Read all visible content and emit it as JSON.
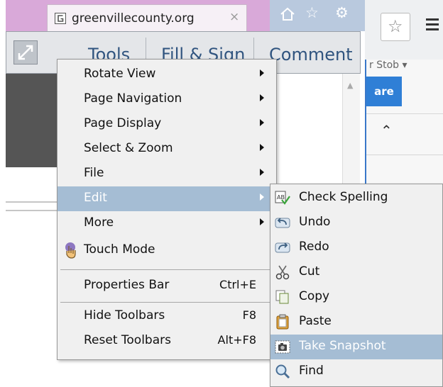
{
  "browser": {
    "tab_title": "greenvillecounty.org",
    "tab_close": "×",
    "nav_icons": [
      "home-icon",
      "star-icon",
      "gear-icon"
    ]
  },
  "toolbar": {
    "tools": "Tools",
    "fill_sign": "Fill & Sign",
    "comment": "Comment"
  },
  "right_panel": {
    "user": "r Stob ▾",
    "share": "are"
  },
  "menu": {
    "items": [
      {
        "label": "Rotate View",
        "submenu": true
      },
      {
        "label": "Page Navigation",
        "submenu": true
      },
      {
        "label": "Page Display",
        "submenu": true
      },
      {
        "label": "Select & Zoom",
        "submenu": true
      },
      {
        "label": "File",
        "submenu": true
      },
      {
        "label": "Edit",
        "submenu": true,
        "highlighted": true
      },
      {
        "label": "More",
        "submenu": true
      },
      {
        "label": "Touch Mode",
        "icon": "touch-hand-icon"
      },
      {
        "label": "Properties Bar",
        "shortcut": "Ctrl+E"
      },
      {
        "label": "Hide Toolbars",
        "shortcut": "F8"
      },
      {
        "label": "Reset Toolbars",
        "shortcut": "Alt+F8"
      }
    ]
  },
  "edit_submenu": {
    "items": [
      {
        "label": "Check Spelling",
        "icon": "spell-check-icon"
      },
      {
        "label": "Undo",
        "icon": "undo-icon"
      },
      {
        "label": "Redo",
        "icon": "redo-icon"
      },
      {
        "label": "Cut",
        "icon": "scissors-icon"
      },
      {
        "label": "Copy",
        "icon": "copy-icon"
      },
      {
        "label": "Paste",
        "icon": "paste-icon"
      },
      {
        "label": "Take Snapshot",
        "icon": "camera-icon",
        "highlighted": true
      },
      {
        "label": "Find",
        "icon": "magnifier-icon"
      }
    ]
  },
  "colors": {
    "highlight": "#a5bdd4",
    "toolbar_text": "#30547f",
    "tab_strip": "#d9a9d9",
    "share_button": "#2f7fd6"
  }
}
